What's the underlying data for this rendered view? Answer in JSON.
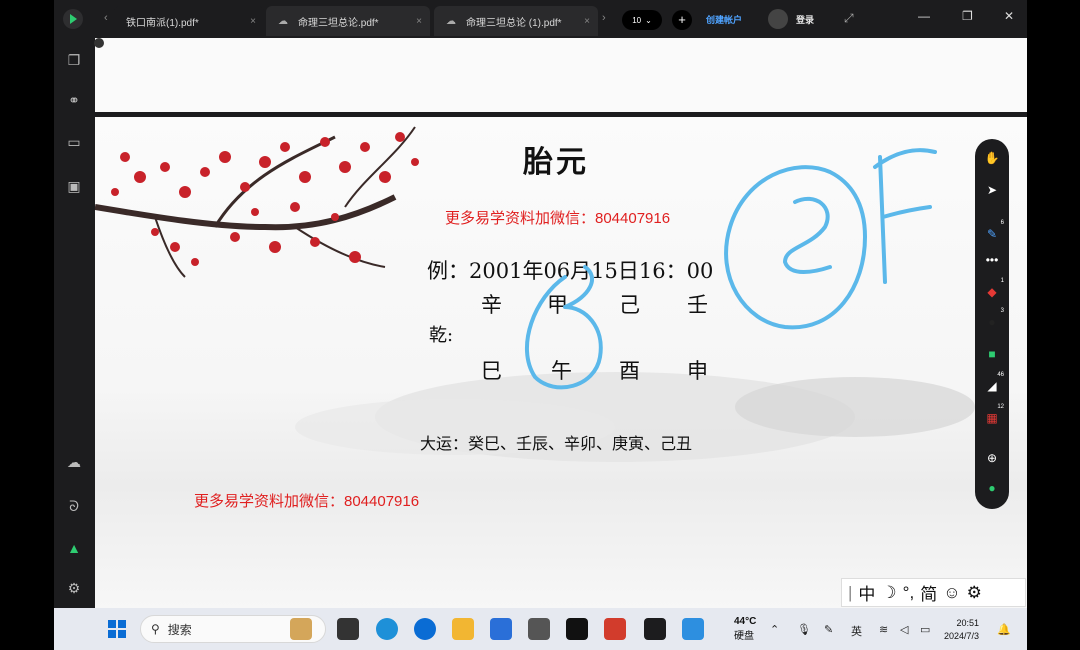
{
  "tabs": [
    {
      "label": "铁口南派(1).pdf*",
      "cloud": false
    },
    {
      "label": "命理三坦总论.pdf*",
      "cloud": true
    },
    {
      "label": "命理三坦总论 (1).pdf*",
      "cloud": true
    }
  ],
  "toolbar": {
    "zoom_value": "10",
    "new_tab": "+",
    "create_account": "创建帐户",
    "login": "登录"
  },
  "slide": {
    "title": "胎元",
    "promo_top": "更多易学资料加微信：804407916",
    "promo_bottom": "更多易学资料加微信：804407916",
    "example": "例：2001年06月15日16：00",
    "qian_label": "乾:",
    "heavenly_stems": [
      "辛",
      "甲",
      "己",
      "壬"
    ],
    "earthly_branches": [
      "巳",
      "午",
      "酉",
      "申"
    ],
    "dayun": "大运：癸巳、壬辰、辛卯、庚寅、己丑"
  },
  "annotations": {
    "ink_color": "#5bb8ea",
    "handwritten": [
      "3",
      "己",
      "F"
    ]
  },
  "pen_toolbar": {
    "tools": [
      {
        "name": "hand-icon",
        "badge": ""
      },
      {
        "name": "pointer-icon",
        "badge": ""
      },
      {
        "name": "pen-icon",
        "badge": "6"
      },
      {
        "name": "more-icon",
        "badge": ""
      },
      {
        "name": "red-pen-icon",
        "badge": "1"
      },
      {
        "name": "marker-icon",
        "badge": "3"
      },
      {
        "name": "highlighter-icon",
        "badge": ""
      },
      {
        "name": "eraser-icon",
        "badge": "46"
      },
      {
        "name": "gift-icon",
        "badge": "12"
      },
      {
        "name": "add-icon",
        "badge": ""
      },
      {
        "name": "app-icon",
        "badge": ""
      }
    ]
  },
  "ime": {
    "items": [
      "中",
      "☽",
      "°,",
      "简",
      "☺",
      "⚙"
    ]
  },
  "taskbar": {
    "search_placeholder": "搜索",
    "weather_temp": "44°C",
    "weather_label": "硬盘",
    "lang": "英",
    "time": "20:51",
    "date": "2024/7/3"
  }
}
